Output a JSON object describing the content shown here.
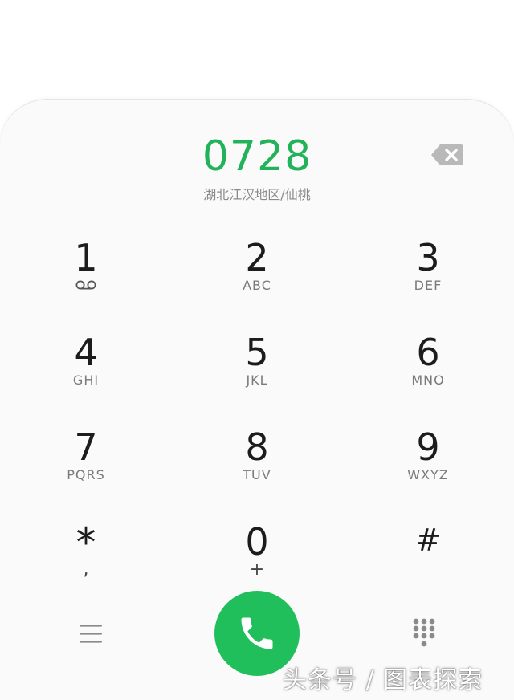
{
  "dialer": {
    "number": "0728",
    "location": "湖北江汉地区/仙桃",
    "accent_color": "#22b35a"
  },
  "keypad": [
    {
      "digit": "1",
      "letters": "",
      "icon": "voicemail-icon"
    },
    {
      "digit": "2",
      "letters": "ABC"
    },
    {
      "digit": "3",
      "letters": "DEF"
    },
    {
      "digit": "4",
      "letters": "GHI"
    },
    {
      "digit": "5",
      "letters": "JKL"
    },
    {
      "digit": "6",
      "letters": "MNO"
    },
    {
      "digit": "7",
      "letters": "PQRS"
    },
    {
      "digit": "8",
      "letters": "TUV"
    },
    {
      "digit": "9",
      "letters": "WXYZ"
    },
    {
      "digit": "*",
      "letters": ","
    },
    {
      "digit": "0",
      "letters": "+"
    },
    {
      "digit": "#",
      "letters": ""
    }
  ],
  "icons": {
    "backspace": "backspace-icon",
    "menu": "menu-icon",
    "call": "phone-icon",
    "dialpad": "dialpad-icon"
  },
  "watermark": "头条号 / 图表探索"
}
